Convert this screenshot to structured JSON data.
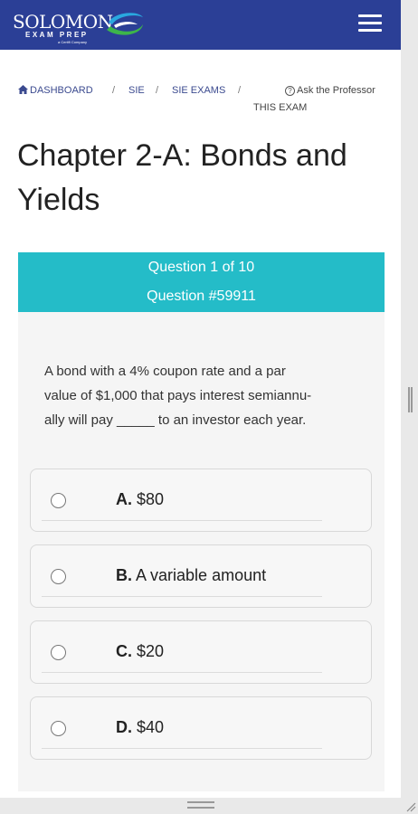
{
  "brand": {
    "name": "SOLOMON",
    "sub": "EXAM PREP",
    "tag": "a Certifi Company",
    "colors": {
      "header": "#2b3f96",
      "accent": "#24bcc8",
      "swoosh_green": "#3db54a",
      "swoosh_blue": "#29a8df"
    }
  },
  "header": {
    "menu_icon": "hamburger-menu-icon"
  },
  "breadcrumb": {
    "home_icon": "home-icon",
    "items": [
      "DASHBOARD",
      "SIE",
      "SIE EXAMS"
    ],
    "separator": "/",
    "ask_icon": "question-circle-icon",
    "ask_line1": "Ask the Professor",
    "ask_line2": "THIS EXAM"
  },
  "page": {
    "title_line1": "Chapter 2-A: Bonds and",
    "title_line2": "Yields"
  },
  "question": {
    "counter": "Question 1 of 10",
    "id": "Question #59911",
    "stem_line1": "A bond with a 4% coupon rate and a par",
    "stem_line2": "value of $1,000 that pays interest semiannu-",
    "stem_line3": "ally will pay _____ to an investor each year.",
    "options": [
      {
        "letter": "A.",
        "text": "$80"
      },
      {
        "letter": "B.",
        "text": "A variable amount"
      },
      {
        "letter": "C.",
        "text": "$20"
      },
      {
        "letter": "D.",
        "text": "$40"
      }
    ]
  }
}
